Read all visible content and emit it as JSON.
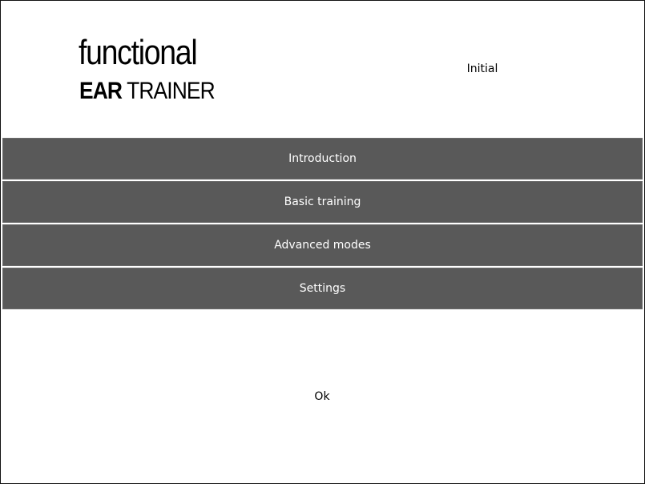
{
  "logo": {
    "line1": "functional",
    "line2_bold": "EAR",
    "line2_rest": " TRAINER"
  },
  "status_label": "Initial",
  "menu": {
    "items": [
      {
        "label": "Introduction"
      },
      {
        "label": "Basic training"
      },
      {
        "label": "Advanced modes"
      },
      {
        "label": "Settings"
      }
    ]
  },
  "ok_label": "Ok",
  "colors": {
    "button_bg": "#595959",
    "button_text": "#ffffff",
    "background": "#ffffff"
  }
}
